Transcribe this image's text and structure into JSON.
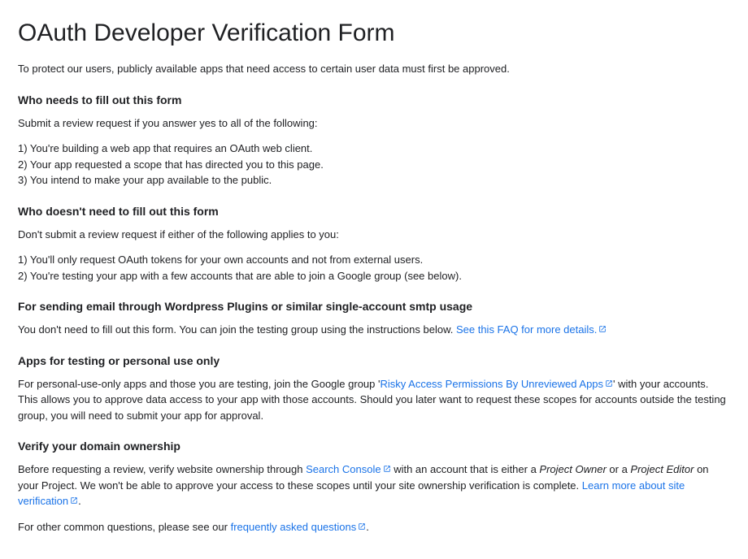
{
  "title": "OAuth Developer Verification Form",
  "intro": "To protect our users, publicly available apps that need access to certain user data must first be approved.",
  "sec1": {
    "heading": "Who needs to fill out this form",
    "lead": "Submit a review request if you answer yes to all of the following:",
    "l1": "1) You're building a web app that requires an OAuth web client.",
    "l2": "2) Your app requested a scope that has directed you to this page.",
    "l3": "3) You intend to make your app available to the public."
  },
  "sec2": {
    "heading": "Who doesn't need to fill out this form",
    "lead": "Don't submit a review request if either of the following applies to you:",
    "l1": "1) You'll only request OAuth tokens for your own accounts and not from external users.",
    "l2": "2) You're testing your app with a few accounts that are able to join a Google group (see below)."
  },
  "sec3": {
    "heading": "For sending email through Wordpress Plugins or similar single-account smtp usage",
    "text1": "You don't need to fill out this form. You can join the testing group using the instructions below. ",
    "link1": "See this FAQ for more details."
  },
  "sec4": {
    "heading": "Apps for testing or personal use only",
    "text1": "For personal-use-only apps and those you are testing, join the Google group '",
    "link1": "Risky Access Permissions By Unreviewed Apps",
    "text2": "' with your accounts. This allows you to approve data access to your app with those accounts. Should you later want to request these scopes for accounts outside the testing group, you will need to submit your app for approval."
  },
  "sec5": {
    "heading": "Verify your domain ownership",
    "text1": "Before requesting a review, verify website ownership through ",
    "link1": "Search Console",
    "text2": " with an account that is either a ",
    "em1": "Project Owner",
    "text3": " or a ",
    "em2": "Project Editor",
    "text4": " on your Project. We won't be able to approve your access to these scopes until your site ownership verification is complete. ",
    "link2": "Learn more about site verification",
    "text5": "."
  },
  "sec6": {
    "text1": "For other common questions, please see our ",
    "link1": "frequently asked questions",
    "text2": "."
  }
}
